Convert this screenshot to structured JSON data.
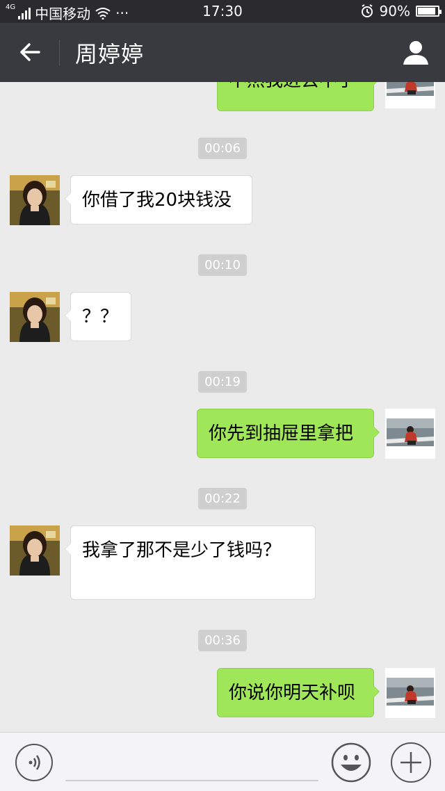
{
  "status_bar": {
    "network": "4G",
    "carrier": "中国移动",
    "more": "···",
    "time": "17:30",
    "battery_level": "90%",
    "battery_fraction": 0.9
  },
  "nav": {
    "title": "周婷婷",
    "back_icon": "arrow-left-icon",
    "contact_icon": "person-icon"
  },
  "messages": [
    {
      "type": "message",
      "direction": "out",
      "text": "不然我进去不了"
    },
    {
      "type": "timestamp",
      "text": "00:06"
    },
    {
      "type": "message",
      "direction": "in",
      "text": "你借了我20块钱没"
    },
    {
      "type": "timestamp",
      "text": "00:10"
    },
    {
      "type": "message",
      "direction": "in",
      "text": "？？"
    },
    {
      "type": "timestamp",
      "text": "00:19"
    },
    {
      "type": "message",
      "direction": "out",
      "text": "你先到抽屉里拿把"
    },
    {
      "type": "timestamp",
      "text": "00:22"
    },
    {
      "type": "message",
      "direction": "in",
      "text": "我拿了那不是少了钱吗？"
    },
    {
      "type": "timestamp",
      "text": "00:36"
    },
    {
      "type": "message",
      "direction": "out",
      "text": "你说你明天补呗"
    }
  ],
  "input_bar": {
    "voice_icon": "voice-icon",
    "emoji_icon": "smiley-icon",
    "plus_icon": "plus-icon"
  },
  "colors": {
    "navbar": "#393a3f",
    "outgoing_bubble": "#9fe658",
    "incoming_bubble": "#ffffff",
    "background": "#ebebeb"
  }
}
